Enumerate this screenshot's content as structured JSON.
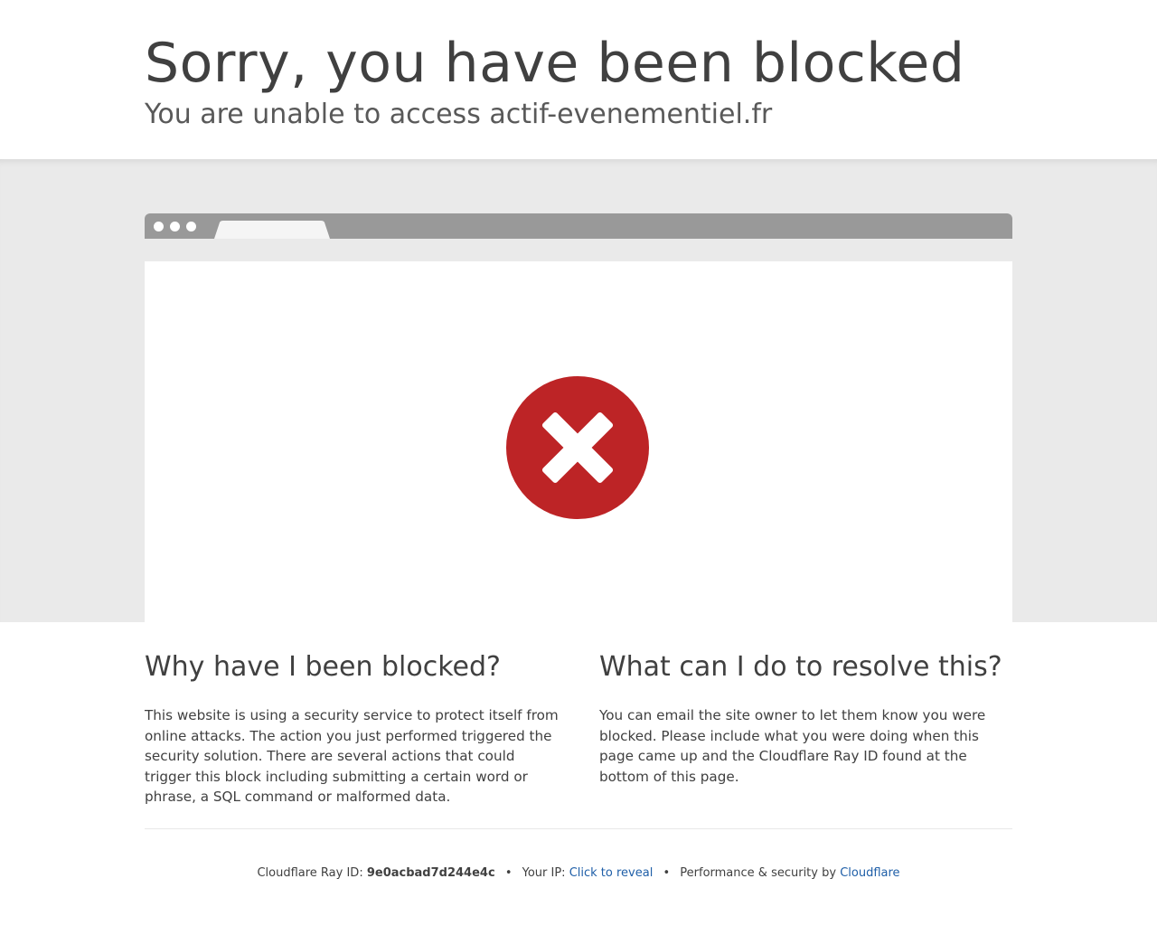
{
  "header": {
    "title": "Sorry, you have been blocked",
    "subtitle": "You are unable to access actif-evenementiel.fr"
  },
  "browser_illustration": {
    "icon": "error-x-icon",
    "colors": {
      "bar": "#999999",
      "window": "#ffffff",
      "error_circle": "#bd2426",
      "band": "#eaeaea"
    }
  },
  "why": {
    "heading": "Why have I been blocked?",
    "body": "This website is using a security service to protect itself from online attacks. The action you just performed triggered the security solution. There are several actions that could trigger this block including submitting a certain word or phrase, a SQL command or malformed data."
  },
  "resolve": {
    "heading": "What can I do to resolve this?",
    "body": "You can email the site owner to let them know you were blocked. Please include what you were doing when this page came up and the Cloudflare Ray ID found at the bottom of this page."
  },
  "footer": {
    "ray_label": "Cloudflare Ray ID:",
    "ray_id": "9e0acbad7d244e4c",
    "separator": "•",
    "ip_label": "Your IP:",
    "ip_link": "Click to reveal",
    "perf_label": "Performance & security by",
    "perf_link": "Cloudflare",
    "link_color": "#1f5fa8"
  }
}
